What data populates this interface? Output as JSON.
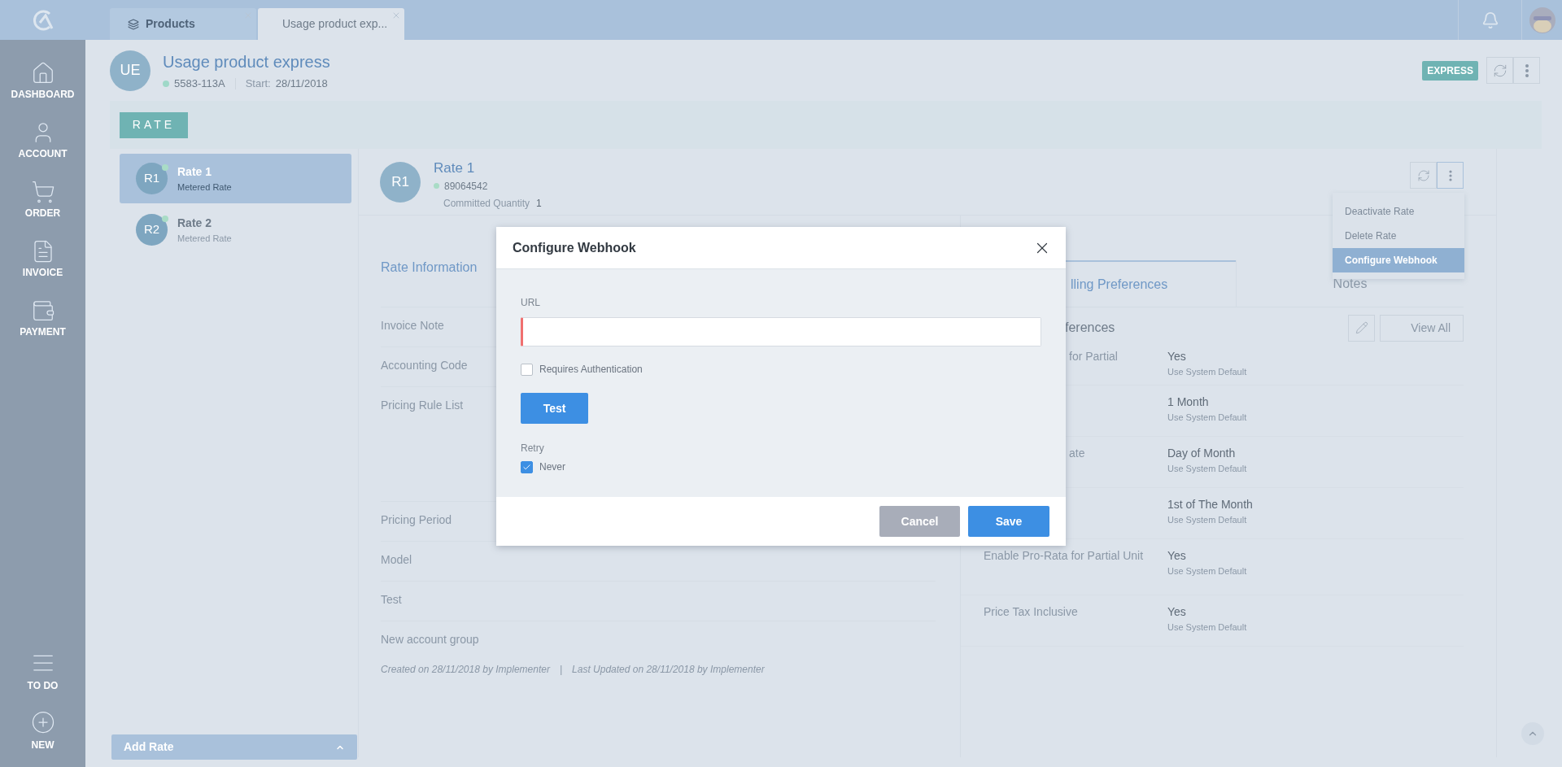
{
  "top_tabs": [
    {
      "label": "Products",
      "selected": false
    },
    {
      "label": "Usage product exp...",
      "selected": true
    }
  ],
  "nav": {
    "items": [
      {
        "label": "DASHBOARD"
      },
      {
        "label": "ACCOUNT"
      },
      {
        "label": "ORDER"
      },
      {
        "label": "INVOICE"
      },
      {
        "label": "PAYMENT"
      }
    ],
    "bottom_items": [
      {
        "label": "TO DO"
      },
      {
        "label": "NEW"
      }
    ]
  },
  "product": {
    "initials": "UE",
    "title": "Usage product express",
    "id": "5583-113A",
    "start_label": "Start:",
    "start_date": "28/11/2018",
    "badge": "EXPRESS"
  },
  "section_tab": "RATE",
  "rates": [
    {
      "initials": "R1",
      "name": "Rate 1",
      "type": "Metered Rate",
      "selected": true
    },
    {
      "initials": "R2",
      "name": "Rate 2",
      "type": "Metered Rate",
      "selected": false
    }
  ],
  "add_rate": "Add Rate",
  "rate": {
    "initials": "R1",
    "name": "Rate 1",
    "id": "89064542",
    "quantity_label": "Committed Quantity",
    "quantity": "1"
  },
  "menu": [
    {
      "label": "Deactivate Rate",
      "selected": false
    },
    {
      "label": "Delete Rate",
      "selected": false
    },
    {
      "label": "Configure Webhook",
      "selected": true
    }
  ],
  "rate_info": {
    "title": "Rate Information",
    "rows": [
      "Invoice Note",
      "Accounting Code",
      "Pricing Rule List",
      "Pricing Period",
      "Model",
      "Test",
      "New account group"
    ],
    "created": "Created on 28/11/2018 by Implementer",
    "separator": "|",
    "updated": "Last Updated on 28/11/2018 by Implementer"
  },
  "detail_tabs": [
    {
      "label": "lling Preferences",
      "selected": true
    },
    {
      "label": "Notes",
      "selected": false
    }
  ],
  "billing": {
    "title": "ferences",
    "view_all": "View All",
    "rows": [
      {
        "label": "for Partial",
        "value": "Yes",
        "note": "Use System Default"
      },
      {
        "value": "1 Month",
        "note": "Use System Default"
      },
      {
        "label": "ate",
        "value": "Day of Month",
        "note": "Use System Default"
      },
      {
        "value": "1st of The Month",
        "note": "Use System Default"
      },
      {
        "label": "Enable Pro-Rata for Partial Unit",
        "value": "Yes",
        "note": "Use System Default"
      },
      {
        "label": "Price Tax Inclusive",
        "value": "Yes",
        "note": "Use System Default"
      }
    ]
  },
  "modal": {
    "title": "Configure Webhook",
    "url_label": "URL",
    "url_invalid": true,
    "auth": {
      "label": "Requires Authentication",
      "checked": false
    },
    "test": "Test",
    "retry_label": "Retry",
    "retry": {
      "label": "Never",
      "checked": true
    },
    "cancel": "Cancel",
    "save": "Save"
  }
}
